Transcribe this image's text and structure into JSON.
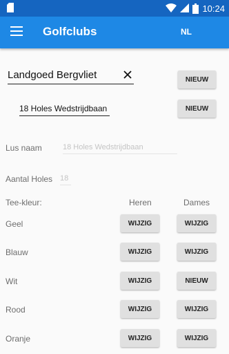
{
  "status": {
    "time": "10:24"
  },
  "appbar": {
    "title": "Golfclubs",
    "language": "NL"
  },
  "club": {
    "value": "Landgoed Bergvliet",
    "new_button": "NIEUW"
  },
  "course": {
    "value": "18 Holes Wedstrijdbaan",
    "new_button": "NIEUW"
  },
  "form": {
    "lus_label": "Lus naam",
    "lus_value": "18 Holes Wedstrijdbaan",
    "holes_label": "Aantal Holes",
    "holes_value": "18",
    "tee_label": "Tee-kleur:",
    "heren_header": "Heren",
    "dames_header": "Dames"
  },
  "tees": [
    {
      "color": "Geel",
      "heren": "WIJZIG",
      "dames": "WIJZIG"
    },
    {
      "color": "Blauw",
      "heren": "WIJZIG",
      "dames": "WIJZIG"
    },
    {
      "color": "Wit",
      "heren": "WIJZIG",
      "dames": "NIEUW"
    },
    {
      "color": "Rood",
      "heren": "WIJZIG",
      "dames": "WIJZIG"
    },
    {
      "color": "Oranje",
      "heren": "WIJZIG",
      "dames": "WIJZIG"
    }
  ]
}
